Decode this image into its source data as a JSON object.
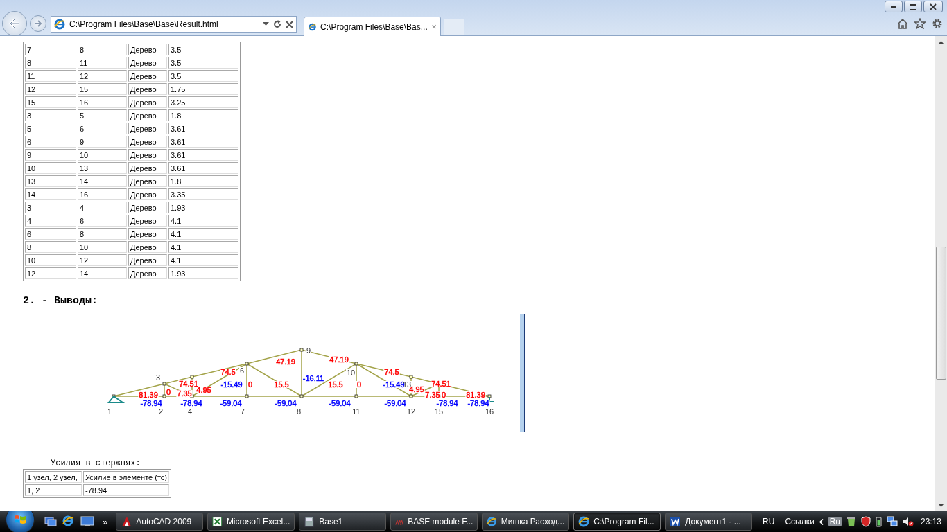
{
  "browser": {
    "address": "C:\\Program Files\\Base\\Base\\Result.html",
    "tabs": [
      {
        "label": "C:\\Program Files\\Base\\Bas...",
        "selected": true
      }
    ]
  },
  "elements_table": {
    "rows": [
      [
        "7",
        "8",
        "Дерево",
        "3.5"
      ],
      [
        "8",
        "11",
        "Дерево",
        "3.5"
      ],
      [
        "11",
        "12",
        "Дерево",
        "3.5"
      ],
      [
        "12",
        "15",
        "Дерево",
        "1.75"
      ],
      [
        "15",
        "16",
        "Дерево",
        "3.25"
      ],
      [
        "3",
        "5",
        "Дерево",
        "1.8"
      ],
      [
        "5",
        "6",
        "Дерево",
        "3.61"
      ],
      [
        "6",
        "9",
        "Дерево",
        "3.61"
      ],
      [
        "9",
        "10",
        "Дерево",
        "3.61"
      ],
      [
        "10",
        "13",
        "Дерево",
        "3.61"
      ],
      [
        "13",
        "14",
        "Дерево",
        "1.8"
      ],
      [
        "14",
        "16",
        "Дерево",
        "3.35"
      ],
      [
        "3",
        "4",
        "Дерево",
        "1.93"
      ],
      [
        "4",
        "6",
        "Дерево",
        "4.1"
      ],
      [
        "6",
        "8",
        "Дерево",
        "4.1"
      ],
      [
        "8",
        "10",
        "Дерево",
        "4.1"
      ],
      [
        "10",
        "12",
        "Дерево",
        "4.1"
      ],
      [
        "12",
        "14",
        "Дерево",
        "1.93"
      ]
    ]
  },
  "section_heading": "2. - Выводы:",
  "diagram": {
    "node_labels": [
      "1",
      "2",
      "3",
      "4",
      "6",
      "7",
      "8",
      "9",
      "10",
      "11",
      "12",
      "13",
      "15",
      "16"
    ],
    "force_labels": [
      {
        "text": "81.39",
        "color": "#ff0000"
      },
      {
        "text": "-78.94",
        "color": "#0000ff"
      },
      {
        "text": "0",
        "color": "#ff0000"
      },
      {
        "text": "74.51",
        "color": "#ff0000"
      },
      {
        "text": "7.35",
        "color": "#ff0000"
      },
      {
        "text": "4.95",
        "color": "#ff0000"
      },
      {
        "text": "74.5",
        "color": "#ff0000"
      },
      {
        "text": "-15.49",
        "color": "#0000ff"
      },
      {
        "text": "0",
        "color": "#ff0000"
      },
      {
        "text": "-78.94",
        "color": "#0000ff"
      },
      {
        "text": "-59.04",
        "color": "#0000ff"
      },
      {
        "text": "47.19",
        "color": "#ff0000"
      },
      {
        "text": "-16.11",
        "color": "#0000ff"
      },
      {
        "text": "15.5",
        "color": "#ff0000"
      },
      {
        "text": "-59.04",
        "color": "#0000ff"
      },
      {
        "text": "47.19",
        "color": "#ff0000"
      },
      {
        "text": "15.5",
        "color": "#ff0000"
      },
      {
        "text": "0",
        "color": "#ff0000"
      },
      {
        "text": "-59.04",
        "color": "#0000ff"
      },
      {
        "text": "74.5",
        "color": "#ff0000"
      },
      {
        "text": "-15.49",
        "color": "#0000ff"
      },
      {
        "text": "4.95",
        "color": "#ff0000"
      },
      {
        "text": "74.51",
        "color": "#ff0000"
      },
      {
        "text": "7.35",
        "color": "#ff0000"
      },
      {
        "text": "0",
        "color": "#ff0000"
      },
      {
        "text": "-59.04",
        "color": "#0000ff"
      },
      {
        "text": "-78.94",
        "color": "#0000ff"
      },
      {
        "text": "81.39",
        "color": "#ff0000"
      },
      {
        "text": "-78.94",
        "color": "#0000ff"
      }
    ]
  },
  "forces_caption": "Усилия в стержнях:",
  "forces_table": {
    "columns": [
      "1 узел, 2 узел,",
      "Усилие в элементе (тс)"
    ],
    "rows": [
      [
        "1, 2",
        "-78.94"
      ]
    ]
  },
  "taskbar": {
    "chevron": "»",
    "tasks": [
      {
        "label": "AutoCAD 2009",
        "kind": "autocad",
        "selected": false
      },
      {
        "label": "Microsoft Excel...",
        "kind": "excel",
        "selected": false
      },
      {
        "label": "Base1",
        "kind": "app",
        "selected": false
      },
      {
        "label": "BASE module F...",
        "kind": "module",
        "selected": false
      },
      {
        "label": "Мишка Расход...",
        "kind": "ie",
        "selected": false
      },
      {
        "label": "C:\\Program Fil...",
        "kind": "ie",
        "selected": true
      },
      {
        "label": "Документ1 - ...",
        "kind": "word",
        "selected": false
      }
    ],
    "language": "RU",
    "links": "Ссылки",
    "tray_lang": "Ru",
    "time": "23:13"
  }
}
